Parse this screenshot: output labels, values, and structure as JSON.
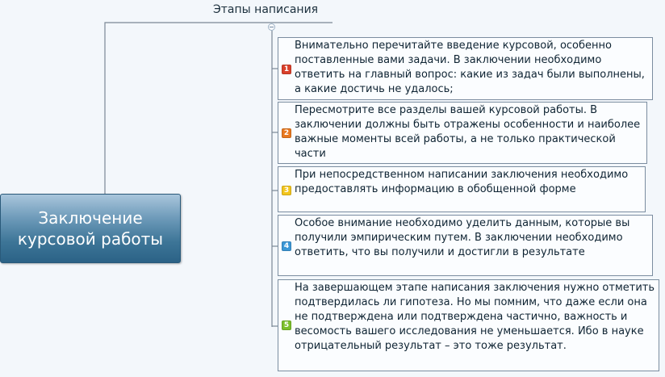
{
  "central_topic": {
    "label": "Заключение\nкурсовой работы",
    "color": "#3d7597"
  },
  "branch": {
    "title": "Этапы написания"
  },
  "items": [
    {
      "number": "1",
      "badge_color": "#d9402b",
      "text": "Внимательно перечитайте введение курсовой, особенно поставленные вами задачи. В заключении необходимо ответить на главный вопрос: какие из задач были выполнены, а какие достичь не удалось;"
    },
    {
      "number": "2",
      "badge_color": "#e8781f",
      "text": "Пересмотрите все разделы вашей курсовой работы. В заключении должны быть отражены особенности и наиболее важные моменты всей работы, а не только практической части"
    },
    {
      "number": "3",
      "badge_color": "#f2c51d",
      "text": "При непосредственном написании заключения необходимо предоставлять информацию в обобщенной форме"
    },
    {
      "number": "4",
      "badge_color": "#3b97d6",
      "text": "Особое внимание необходимо уделить данным, которые вы получили эмпирическим путем. В заключении необходимо ответить, что вы получили и достигли в результате"
    },
    {
      "number": "5",
      "badge_color": "#7bbf2a",
      "text": "На завершающем этапе написания заключения нужно отметить подтвердилась ли гипотеза. Но мы помним, что даже если она не подтверждена или подтверждена частично, важность и весомость вашего исследования не уменьшается. Ибо в науке отрицательный результат – это тоже результат."
    }
  ]
}
